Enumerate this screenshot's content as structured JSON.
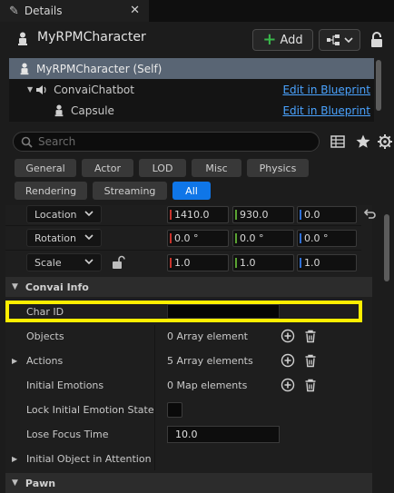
{
  "tab": {
    "title": "Details",
    "close": "✕"
  },
  "header": {
    "actor_name": "MyRPMCharacter",
    "add_label": "Add"
  },
  "tree": {
    "items": [
      {
        "label": "MyRPMCharacter (Self)",
        "link": ""
      },
      {
        "label": "ConvaiChatbot",
        "link": "Edit in Blueprint"
      },
      {
        "label": "Capsule",
        "link": "Edit in Blueprint"
      }
    ]
  },
  "search": {
    "placeholder": "Search"
  },
  "filters": {
    "row1": [
      "General",
      "Actor",
      "LOD",
      "Misc",
      "Physics"
    ],
    "row2": [
      "Rendering",
      "Streaming",
      "All"
    ],
    "active": "All"
  },
  "transform": {
    "location": {
      "label": "Location",
      "x": "1410.0",
      "y": "930.0",
      "z": "0.0"
    },
    "rotation": {
      "label": "Rotation",
      "x": "0.0 °",
      "y": "0.0 °",
      "z": "0.0 °"
    },
    "scale": {
      "label": "Scale",
      "x": "1.0",
      "y": "1.0",
      "z": "1.0"
    }
  },
  "convai": {
    "section_title": "Convai Info",
    "char_id_label": "Char ID",
    "char_id_value": "",
    "objects_label": "Objects",
    "objects_value": "0 Array element",
    "actions_label": "Actions",
    "actions_value": "5 Array elements",
    "emotions_label": "Initial Emotions",
    "emotions_value": "0 Map elements",
    "lock_label": "Lock Initial Emotion State",
    "lose_label": "Lose Focus Time",
    "lose_value": "10.0",
    "attention_label": "Initial Object in Attention"
  },
  "pawn": {
    "section_title": "Pawn"
  },
  "colors": {
    "accent": "#0f76e8",
    "highlight": "#ffee00",
    "link": "#4aa3ff",
    "x_axis": "#c8332c",
    "y_axis": "#5aa332",
    "z_axis": "#2f6fd6"
  }
}
